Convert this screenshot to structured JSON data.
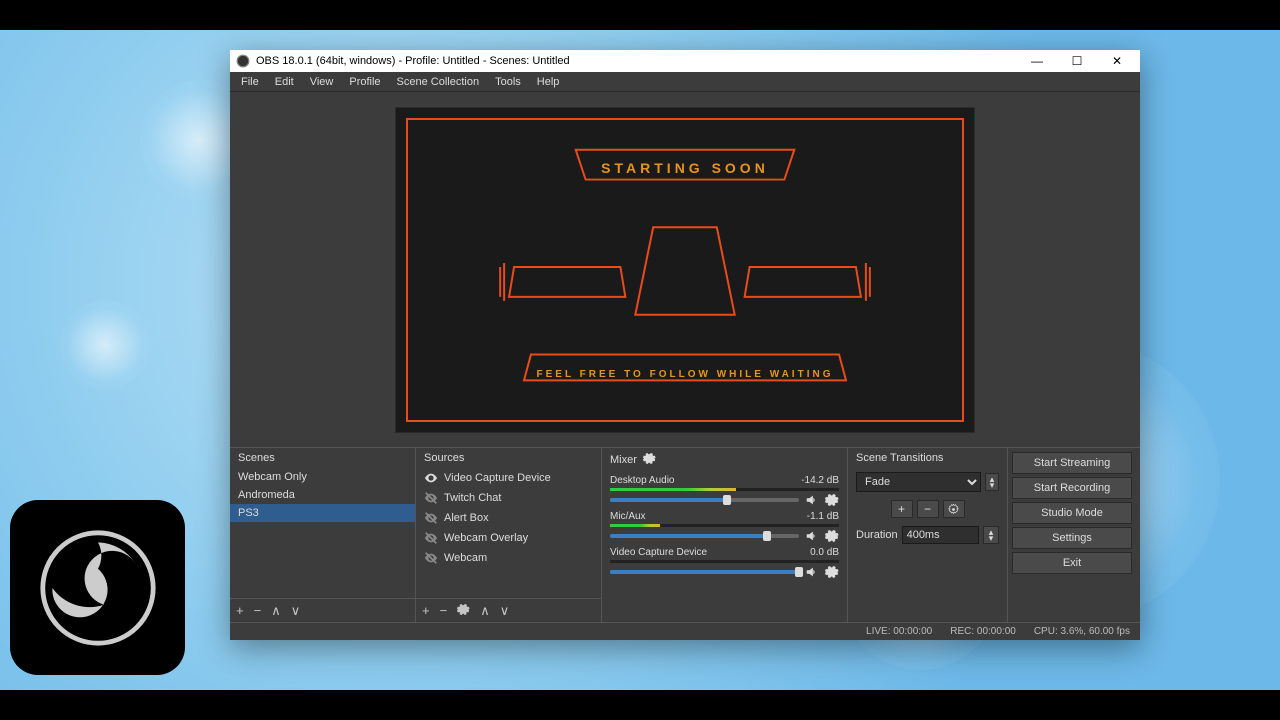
{
  "window": {
    "title": "OBS 18.0.1 (64bit, windows) - Profile: Untitled - Scenes: Untitled"
  },
  "menu": {
    "file": "File",
    "edit": "Edit",
    "view": "View",
    "profile": "Profile",
    "scene_collection": "Scene Collection",
    "tools": "Tools",
    "help": "Help"
  },
  "preview": {
    "heading": "STARTING SOON",
    "subtext": "FEEL FREE TO FOLLOW WHILE WAITING",
    "accent": "#e84c1a"
  },
  "scenes": {
    "title": "Scenes",
    "items": [
      "Webcam Only",
      "Andromeda",
      "PS3"
    ],
    "selected": 2
  },
  "sources": {
    "title": "Sources",
    "items": [
      {
        "label": "Video Capture Device",
        "visible": true
      },
      {
        "label": "Twitch Chat",
        "visible": false
      },
      {
        "label": "Alert Box",
        "visible": false
      },
      {
        "label": "Webcam Overlay",
        "visible": false
      },
      {
        "label": "Webcam",
        "visible": false
      }
    ]
  },
  "mixer": {
    "title": "Mixer",
    "channels": [
      {
        "name": "Desktop Audio",
        "db": "-14.2 dB",
        "level": 55,
        "vol": 62
      },
      {
        "name": "Mic/Aux",
        "db": "-1.1 dB",
        "level": 22,
        "vol": 83
      },
      {
        "name": "Video Capture Device",
        "db": "0.0 dB",
        "level": 0,
        "vol": 100
      }
    ]
  },
  "transitions": {
    "title": "Scene Transitions",
    "selected": "Fade",
    "duration_label": "Duration",
    "duration_value": "400ms"
  },
  "controls": {
    "start_streaming": "Start Streaming",
    "start_recording": "Start Recording",
    "studio_mode": "Studio Mode",
    "settings": "Settings",
    "exit": "Exit"
  },
  "status": {
    "live": "LIVE: 00:00:00",
    "rec": "REC: 00:00:00",
    "cpu": "CPU: 3.6%, 60.00 fps"
  }
}
